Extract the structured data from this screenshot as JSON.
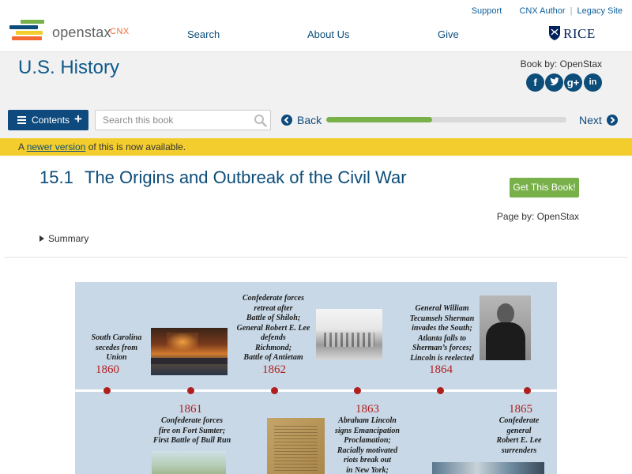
{
  "header": {
    "logo_text": "openstax",
    "logo_cnx": "CNX",
    "util_links": [
      "Support",
      "CNX Author",
      "Legacy Site"
    ],
    "nav": [
      "Search",
      "About Us",
      "Give"
    ],
    "rice_text": "RICE"
  },
  "book": {
    "title": "U.S. History",
    "book_by": "Book by: OpenStax",
    "social": [
      "f",
      "t",
      "g+",
      "in"
    ],
    "contents_label": "Contents",
    "search_placeholder": "Search this book",
    "back_label": "Back",
    "next_label": "Next",
    "progress": 0.44
  },
  "notice": {
    "prefix": "A ",
    "link": "newer version",
    "suffix": " of this is now available."
  },
  "page": {
    "section_number": "15.1",
    "section_title": "The Origins and Outbreak of the Civil War",
    "get_book_label": "Get This Book!",
    "page_by": "Page by: OpenStax",
    "summary_label": "Summary"
  },
  "timeline": {
    "events": [
      {
        "year": "1860",
        "text": "South Carolina\nsecedes from\nUnion"
      },
      {
        "year": "1861",
        "text": "Confederate forces\nfire on Fort Sumter;\nFirst Battle of Bull Run"
      },
      {
        "year": "1862",
        "text": "Confederate forces\nretreat after\nBattle of Shiloh;\nGeneral Robert E. Lee\ndefends\nRichmond;\nBattle of Antietam"
      },
      {
        "year": "1863",
        "text": "Abraham Lincoln\nsigns Emancipation\nProclamation;\nRacially motivated\nriots break out\nin New York;"
      },
      {
        "year": "1864",
        "text": "General William\nTecumseh Sherman\ninvades the South;\nAtlanta falls to\nSherman’s forces;\nLincoln is reelected"
      },
      {
        "year": "1865",
        "text": "Confederate\ngeneral\nRobert E. Lee\nsurrenders"
      }
    ]
  },
  "colors": {
    "brand_blue": "#0c4d7a",
    "accent_green": "#78b04a",
    "notice_yellow": "#f2cd2d",
    "timeline_red": "#b01e1e",
    "timeline_bg": "#c8d8e6"
  }
}
